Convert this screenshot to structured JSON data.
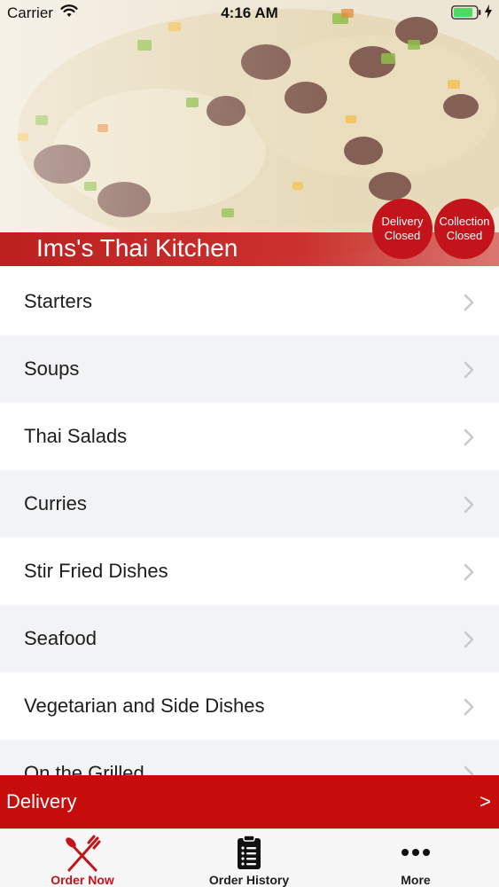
{
  "status_bar": {
    "carrier": "Carrier",
    "time": "4:16 AM",
    "icons": [
      "wifi-icon",
      "battery-icon",
      "charging-bolt-icon"
    ]
  },
  "hero": {
    "title": "Ims's Thai Kitchen",
    "delivery_status": {
      "line1": "Delivery",
      "line2": "Closed"
    },
    "collection_status": {
      "line1": "Collection",
      "line2": "Closed"
    }
  },
  "menu": {
    "categories": [
      {
        "label": "Starters"
      },
      {
        "label": "Soups"
      },
      {
        "label": "Thai Salads"
      },
      {
        "label": "Curries"
      },
      {
        "label": "Stir Fried Dishes"
      },
      {
        "label": "Seafood"
      },
      {
        "label": "Vegetarian and Side Dishes"
      },
      {
        "label": "On the Grilled"
      }
    ]
  },
  "delivery_bar": {
    "label": "Delivery",
    "arrow": ">"
  },
  "tab_bar": {
    "tabs": [
      {
        "label": "Order Now",
        "icon": "fork-knife-icon",
        "active": true
      },
      {
        "label": "Order History",
        "icon": "clipboard-list-icon",
        "active": false
      },
      {
        "label": "More",
        "icon": "more-dots-icon",
        "active": false
      }
    ]
  },
  "colors": {
    "brand_red": "#c4141b",
    "delivery_bar": "#c70c0c",
    "row_alt": "#f2f3f4"
  }
}
